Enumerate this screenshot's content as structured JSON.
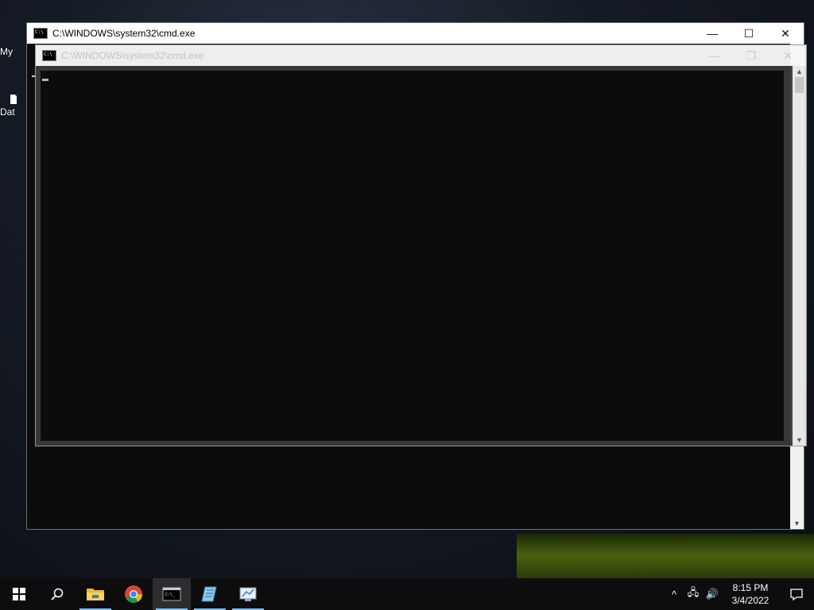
{
  "desktop": {
    "icons": [
      {
        "label": "My",
        "icon": "computer-icon"
      },
      {
        "label": "Dat",
        "icon": "file-icon"
      }
    ]
  },
  "back_window": {
    "title": "C:\\WINDOWS\\system32\\cmd.exe",
    "minimize": "—",
    "maximize": "☐",
    "close": "✕"
  },
  "front_window": {
    "title": "C:\\WINDOWS\\system32\\cmd.exe",
    "minimize": "—",
    "maximize": "❐",
    "close": "✕"
  },
  "taskbar": {
    "apps": [
      {
        "name": "file-explorer-icon"
      },
      {
        "name": "chrome-icon"
      },
      {
        "name": "cmd-icon",
        "active": true
      },
      {
        "name": "app-icon-blue"
      },
      {
        "name": "app-icon-network"
      }
    ],
    "tray": {
      "chevron": "^",
      "network": "🖧",
      "volume": "🔊",
      "time": "8:15 PM",
      "date": "3/4/2022"
    }
  },
  "colors": {
    "accent": "#76b9ed",
    "console_bg": "#0c0c0c",
    "taskbar_bg": "#0d0d0d"
  }
}
